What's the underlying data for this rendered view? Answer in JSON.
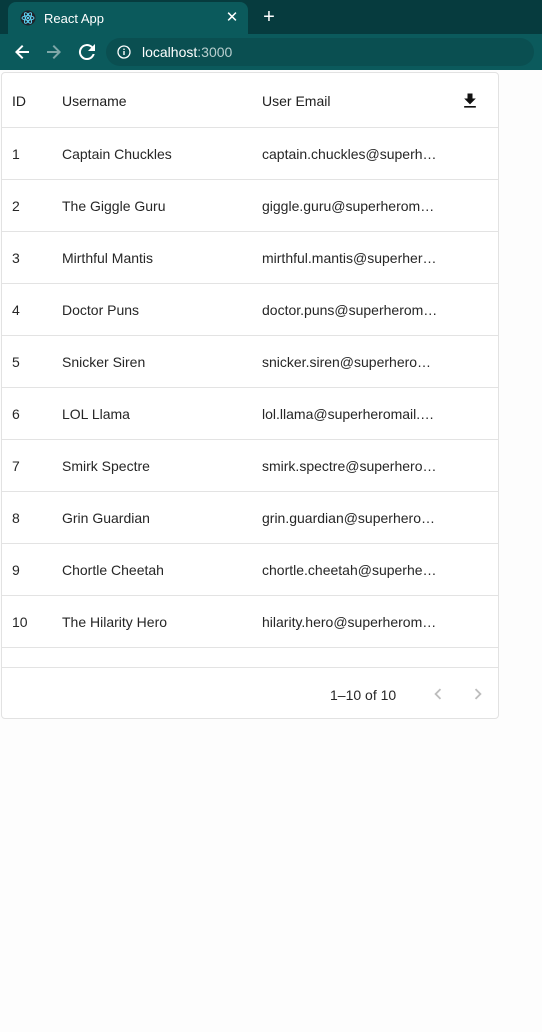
{
  "browser": {
    "tab_title": "React App",
    "tab_favicon_icon": "react-logo-icon",
    "url_host": "localhost",
    "url_port": ":3000"
  },
  "grid": {
    "columns": {
      "id": "ID",
      "username": "Username",
      "email": "User Email"
    },
    "rows": [
      {
        "id": "1",
        "username": "Captain Chuckles",
        "email": "captain.chuckles@superh…"
      },
      {
        "id": "2",
        "username": "The Giggle Guru",
        "email": "giggle.guru@superherom…"
      },
      {
        "id": "3",
        "username": "Mirthful Mantis",
        "email": "mirthful.mantis@superher…"
      },
      {
        "id": "4",
        "username": "Doctor Puns",
        "email": "doctor.puns@superherom…"
      },
      {
        "id": "5",
        "username": "Snicker Siren",
        "email": "snicker.siren@superhero…"
      },
      {
        "id": "6",
        "username": "LOL Llama",
        "email": "lol.llama@superheromail.…"
      },
      {
        "id": "7",
        "username": "Smirk Spectre",
        "email": "smirk.spectre@superhero…"
      },
      {
        "id": "8",
        "username": "Grin Guardian",
        "email": "grin.guardian@superhero…"
      },
      {
        "id": "9",
        "username": "Chortle Cheetah",
        "email": "chortle.cheetah@superhe…"
      },
      {
        "id": "10",
        "username": "The Hilarity Hero",
        "email": "hilarity.hero@superherom…"
      }
    ],
    "pagination": "1–10 of 10"
  },
  "colors": {
    "tabbar": "#063b3e",
    "toolbar": "#0b5a5c",
    "page_bg": "#fdfdfd"
  }
}
